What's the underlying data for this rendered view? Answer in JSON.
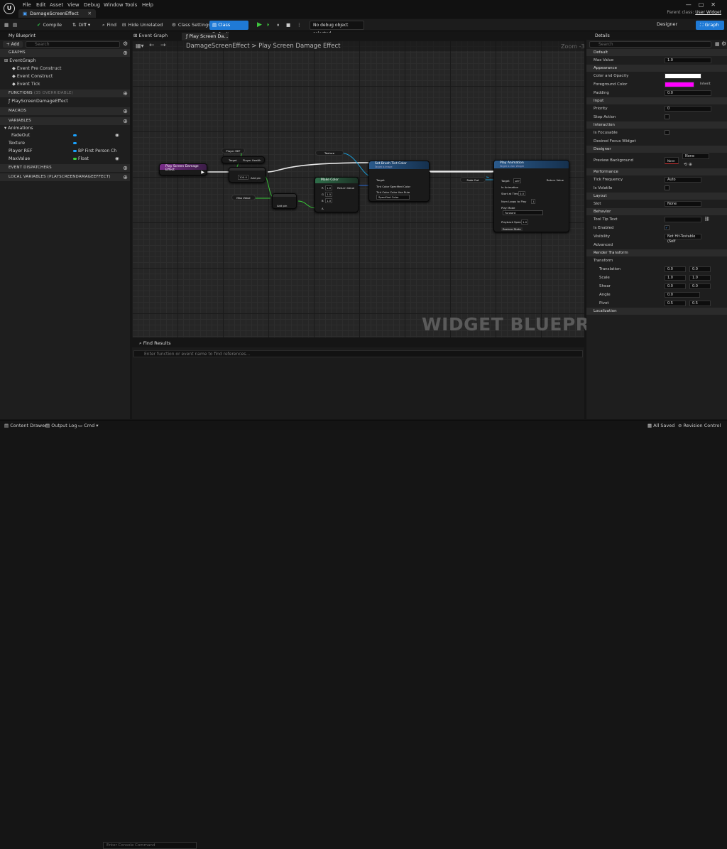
{
  "title_bar": {
    "menu": [
      "File",
      "Edit",
      "Asset",
      "View",
      "Debug",
      "Window",
      "Tools",
      "Help"
    ],
    "doc_tab": "DamageScreenEffect",
    "parent_class_label": "Parent class:",
    "parent_class_value": "User Widget"
  },
  "toolbar": {
    "compile": "Compile",
    "diff": "Diff",
    "find": "Find",
    "hide_unrelated": "Hide Unrelated",
    "class_settings": "Class Settings",
    "class_defaults": "Class Defaults",
    "debug_object": "No debug object selected",
    "designer": "Designer",
    "graph": "Graph"
  },
  "my_blueprint": {
    "tab": "My Blueprint",
    "add": "+ Add",
    "search_placeholder": "Search",
    "graphs_header": "GRAPHS",
    "event_graph": "EventGraph",
    "events": [
      "Event Pre Construct",
      "Event Construct",
      "Event Tick"
    ],
    "functions_header": "FUNCTIONS",
    "functions_suffix": "(35 OVERRIDABLE)",
    "functions": [
      "PlayScreenDamageEffect"
    ],
    "macros_header": "MACROS",
    "variables_header": "VARIABLES",
    "animations_label": "Animations",
    "variables": [
      {
        "name": "FadeOut",
        "type": ""
      },
      {
        "name": "Texture",
        "type": ""
      },
      {
        "name": "Player REF",
        "type": "BP First Person Ch"
      },
      {
        "name": "MaxValue",
        "type": "Float"
      }
    ],
    "event_dispatchers_header": "EVENT DISPATCHERS",
    "local_variables_header": "LOCAL VARIABLES (PLAYSCREENDAMAGEEFFECT)"
  },
  "graph": {
    "tabs": [
      "Event Graph",
      "Play Screen Da..."
    ],
    "breadcrumb": "DamageScreenEffect > Play Screen Damage Effect",
    "zoom": "Zoom -3",
    "watermark": "WIDGET BLUEPRINT",
    "nodes": {
      "entry": "Play Screen Damage Effect",
      "player_ref": "Player REF",
      "player_health": "Player Health",
      "target": "Target",
      "add_pin": "Add pin",
      "max_value": "Max Value",
      "texture": "Texture",
      "make_color": "Make Color",
      "return_value": "Return Value",
      "r": "R",
      "g": "G",
      "b": "B",
      "a": "A",
      "value_100": "100.0",
      "value_1": "1.0",
      "set_brush": "Set Brush Tint Color",
      "set_brush_sub": "Target is Image",
      "in_tint": "Tint Color Specified Color",
      "in_tint_rule": "Tint Color Color Use Rule",
      "specified_color": "Specified Color",
      "fade_out": "Fade Out",
      "play_anim": "Play Animation",
      "play_anim_sub": "Target is User Widget",
      "self": "self",
      "in_animation": "In Animation",
      "start_at": "Start at Time",
      "num_loops": "Num Loops to Play",
      "play_mode": "Play Mode",
      "forward": "Forward",
      "playback_speed": "Playback Speed",
      "restore_state": "Restore State",
      "v0": "0.0",
      "v1": "1",
      "v1f": "1.0"
    }
  },
  "find_results": {
    "tab": "Find Results",
    "placeholder": "Enter function or event name to find references..."
  },
  "details": {
    "tab": "Details",
    "search_placeholder": "Search",
    "sections": [
      {
        "title": "Default",
        "rows": [
          {
            "label": "Max Value",
            "value": "1.0"
          }
        ]
      },
      {
        "title": "Appearance",
        "rows": [
          {
            "label": "Color and Opacity",
            "value": ""
          },
          {
            "label": "Foreground Color",
            "value": "Inherit"
          },
          {
            "label": "Padding",
            "value": "0.0"
          }
        ]
      },
      {
        "title": "Input",
        "rows": [
          {
            "label": "Priority",
            "value": "0"
          },
          {
            "label": "Stop Action",
            "value": ""
          }
        ]
      },
      {
        "title": "Interaction",
        "rows": [
          {
            "label": "Is Focusable",
            "value": ""
          },
          {
            "label": "Desired Focus Widget",
            "value": ""
          }
        ]
      },
      {
        "title": "Designer",
        "rows": [
          {
            "label": "Preview Background",
            "value": "None"
          }
        ]
      },
      {
        "title": "Performance",
        "rows": [
          {
            "label": "Tick Frequency",
            "value": "Auto"
          },
          {
            "label": "Is Volatile",
            "value": ""
          }
        ]
      },
      {
        "title": "Layout",
        "rows": [
          {
            "label": "Slot",
            "value": "None"
          }
        ]
      },
      {
        "title": "Behavior",
        "rows": [
          {
            "label": "Tool Tip Text",
            "value": ""
          },
          {
            "label": "Is Enabled",
            "value": ""
          },
          {
            "label": "Visibility",
            "value": "Not Hit-Testable (Self"
          },
          {
            "label": "Advanced",
            "value": ""
          }
        ]
      },
      {
        "title": "Render Transform",
        "rows": [
          {
            "label": "Transform",
            "value": ""
          },
          {
            "label": "Translation",
            "value": "0.0"
          },
          {
            "label": "Scale",
            "value": "1.0"
          },
          {
            "label": "Shear",
            "value": "0.0"
          },
          {
            "label": "Angle",
            "value": "0.0"
          },
          {
            "label": "Pivot",
            "value": "0.5"
          }
        ]
      },
      {
        "title": "Localization",
        "rows": []
      }
    ],
    "preview_bg_dropdown": "None",
    "translation_y": "0.0",
    "scale_y": "1.0",
    "shear_y": "0.0",
    "pivot_y": "0.5",
    "colors": {
      "white": "#ffffff",
      "magenta": "#ff00ff"
    }
  },
  "status_bar": {
    "content_drawer": "Content Drawer",
    "output_log": "Output Log",
    "cmd": "Cmd",
    "console_placeholder": "Enter Console Command",
    "all_saved": "All Saved",
    "revision_control": "Revision Control"
  }
}
